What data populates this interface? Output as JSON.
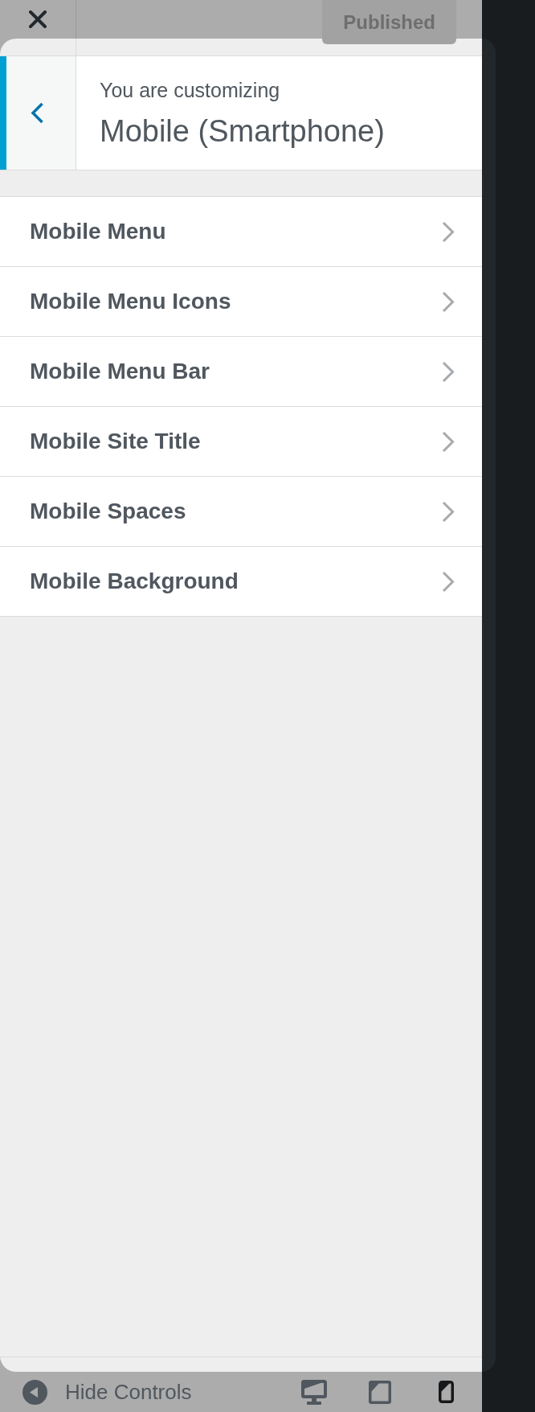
{
  "top_bar": {
    "publish_button": {
      "label": "Published",
      "disabled": true
    }
  },
  "header": {
    "back_button": {
      "focused": true
    },
    "caption": "You are customizing",
    "title": "Mobile (Smartphone)"
  },
  "sections": [
    {
      "label": "Mobile Menu"
    },
    {
      "label": "Mobile Menu Icons"
    },
    {
      "label": "Mobile Menu Bar"
    },
    {
      "label": "Mobile Site Title"
    },
    {
      "label": "Mobile Spaces"
    },
    {
      "label": "Mobile Background"
    }
  ],
  "footer": {
    "hide_controls": "Hide Controls",
    "devices": [
      {
        "kind": "desktop",
        "selected": false
      },
      {
        "kind": "tablet",
        "selected": false
      },
      {
        "kind": "mobile",
        "selected": true
      }
    ]
  }
}
